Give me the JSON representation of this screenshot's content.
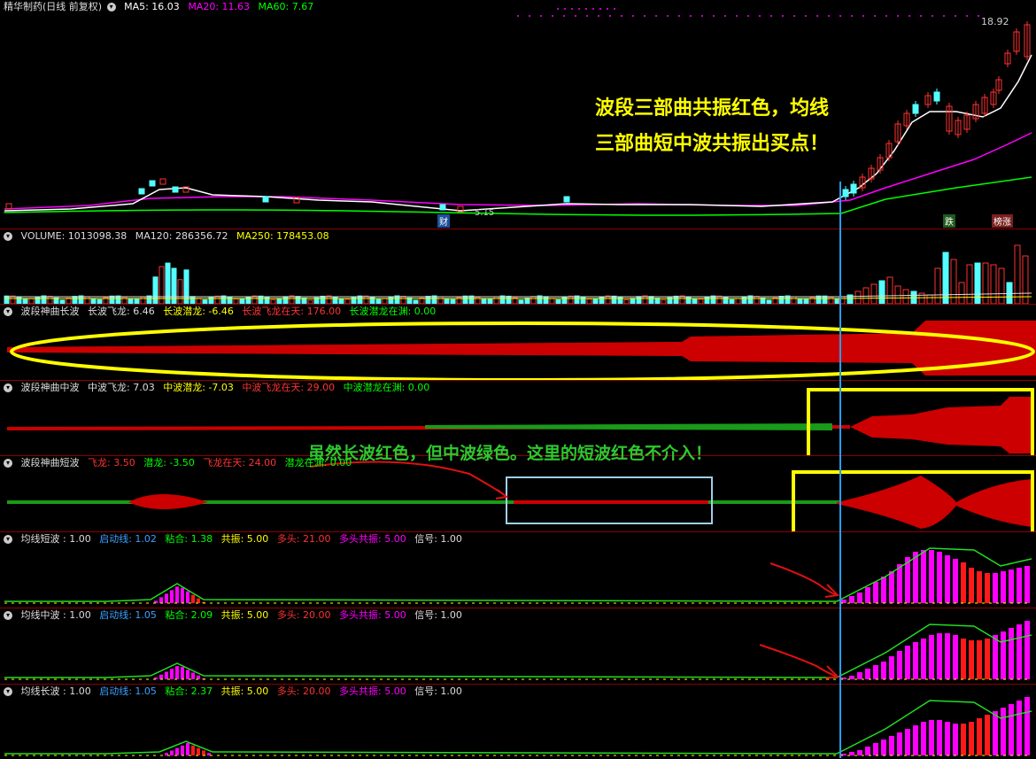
{
  "main": {
    "title": "精华制药(日线 前复权)",
    "ma5": "MA5: 16.03",
    "ma20": "MA20: 11.63",
    "ma60": "MA60: 7.67",
    "price_high": "18.92",
    "price_low": "5.15",
    "tag_cai": "财",
    "tag_die": "跌",
    "tag_bangzhang": "榜涨",
    "annotation_line1": "波段三部曲共振红色，均线",
    "annotation_line2": "三部曲短中波共振出买点！"
  },
  "volume": {
    "label": "VOLUME: 1013098.38",
    "ma120": "MA120: 286356.72",
    "ma250": "MA250: 178453.08"
  },
  "long_wave": {
    "title": "波段神曲长波",
    "fly": "长波飞龙: 6.46",
    "dive": "长波潜龙: -6.46",
    "sky": "长波飞龙在天: 176.00",
    "abyss": "长波潜龙在渊: 0.00"
  },
  "mid_wave": {
    "title": "波段神曲中波",
    "fly": "中波飞龙: 7.03",
    "dive": "中波潜龙: -7.03",
    "sky": "中波飞龙在天: 29.00",
    "abyss": "中波潜龙在渊: 0.00"
  },
  "short_wave": {
    "title": "波段神曲短波",
    "fly": "飞龙: 3.50",
    "dive": "潜龙: -3.50",
    "sky": "飞龙在天: 24.00",
    "abyss": "潜龙在渊: 0.00",
    "annotation": "虽然长波红色，但中波绿色。这里的短波红色不介入！"
  },
  "ma_short": {
    "title": "均线短波 : 1.00",
    "start": "启动线: 1.02",
    "bond": "粘合: 1.38",
    "reson": "共振: 5.00",
    "bull": "多头: 21.00",
    "bull_reson": "多头共振: 5.00",
    "signal": "信号: 1.00"
  },
  "ma_mid": {
    "title": "均线中波 : 1.00",
    "start": "启动线: 1.05",
    "bond": "粘合: 2.09",
    "reson": "共振: 5.00",
    "bull": "多头: 20.00",
    "bull_reson": "多头共振: 5.00",
    "signal": "信号: 1.00"
  },
  "ma_long": {
    "title": "均线长波 : 1.00",
    "start": "启动线: 1.05",
    "bond": "粘合: 2.37",
    "reson": "共振: 5.00",
    "bull": "多头: 20.00",
    "bull_reson": "多头共振: 5.00",
    "signal": "信号: 1.00"
  },
  "colors": {
    "up": "#ff3232",
    "down": "#54ffff",
    "ma5": "#ffffff",
    "ma20": "#ff00ff",
    "ma60": "#00ff00",
    "wave_red": "#cc0000",
    "wave_green": "#1a9a1a",
    "yellow": "#ffff00",
    "magenta": "#ff00ff",
    "cyan_line": "#2a9df4"
  },
  "chart_data": {
    "type": "candlestick",
    "price_ylim": [
      5.15,
      18.92
    ],
    "close_tail": [
      6.8,
      7.2,
      7.9,
      8.6,
      9.8,
      10.9,
      11.8,
      12.9,
      13.4,
      13.1,
      12.8,
      12.6,
      12.4,
      13.0,
      14.2,
      15.6,
      16.8,
      18.1,
      18.92
    ]
  }
}
